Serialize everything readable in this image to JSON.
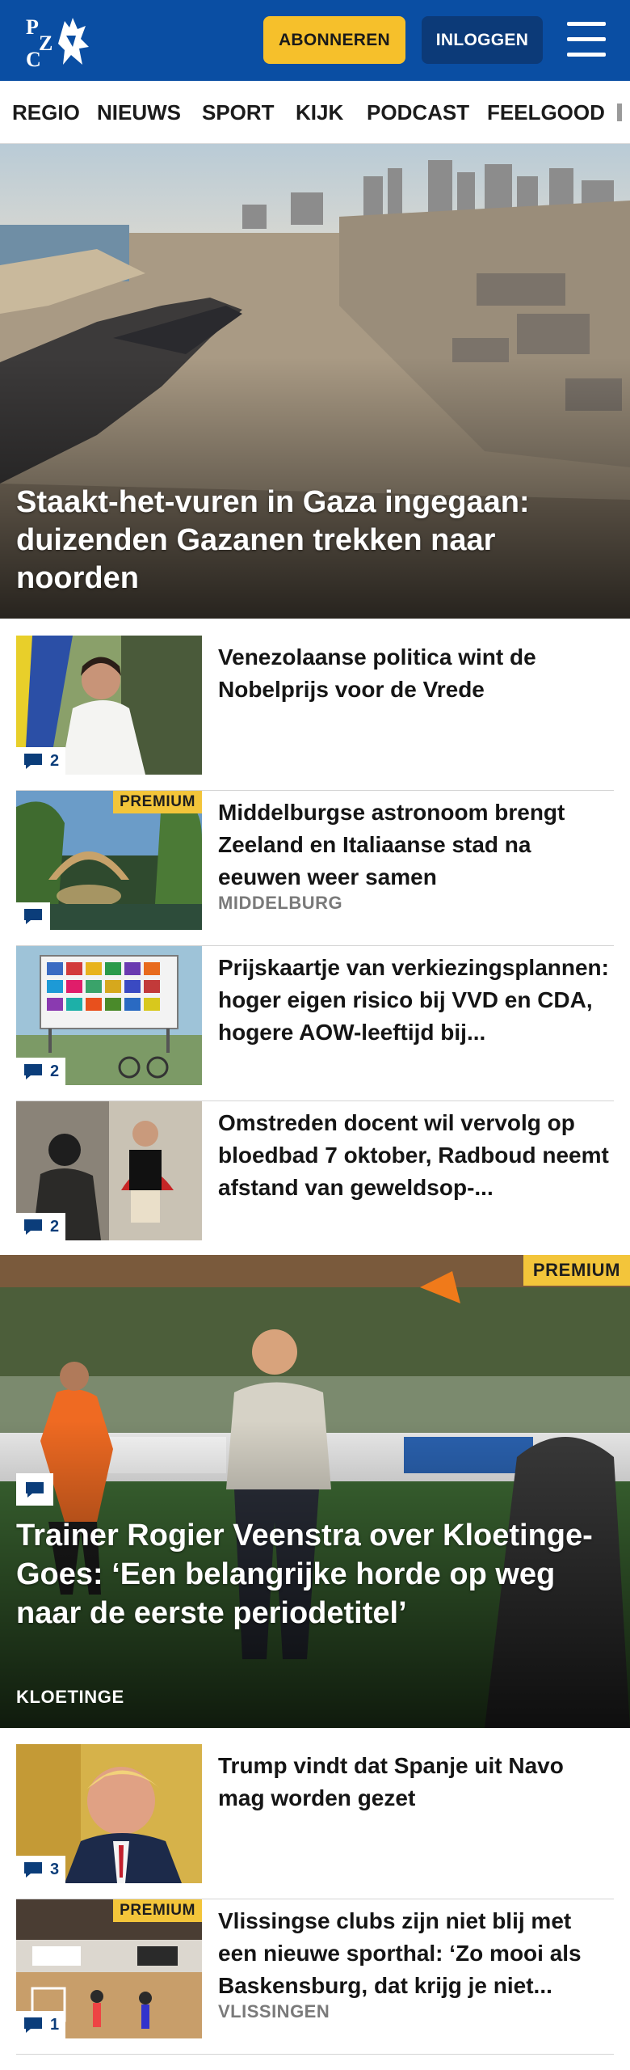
{
  "header": {
    "logo_text": "PZC",
    "subscribe_label": "ABONNEREN",
    "login_label": "INLOGGEN",
    "brand_color": "#0a4ea3",
    "accent_color": "#f6c02b"
  },
  "nav": {
    "items": [
      {
        "label": "REGIO"
      },
      {
        "label": "NIEUWS"
      },
      {
        "label": "SPORT"
      },
      {
        "label": "KIJK"
      },
      {
        "label": "PODCAST"
      },
      {
        "label": "FEELGOOD"
      }
    ]
  },
  "hero": {
    "title": "Staakt-het-vuren in Gaza ingegaan: duizenden Gazanen trekken naar noorden"
  },
  "articles": [
    {
      "title": "Venezolaanse politica wint de Nobelprijs voor de Vrede",
      "comments": "2",
      "premium": "",
      "label": ""
    },
    {
      "title": "Middelburgse astronoom brengt Zeeland en Italiaanse stad na eeuwen weer samen",
      "comments": "",
      "premium": "PREMIUM",
      "label": "MIDDELBURG"
    },
    {
      "title": "Prijskaartje van verkiezingsplan­nen: hoger eigen risico bij VVD en CDA, hogere AOW-leeftijd bij...",
      "comments": "2",
      "premium": "",
      "label": ""
    },
    {
      "title": "Omstreden docent wil vervolg op bloedbad 7 oktober, Radboud neemt afstand van geweldsop-...",
      "comments": "2",
      "premium": "",
      "label": ""
    }
  ],
  "feature": {
    "premium": "PREMIUM",
    "title": "Trainer Rogier Veenstra over Kloetinge-Goes: ‘Een belangrijke horde op weg naar de eerste periodeti­tel’",
    "label": "KLOETINGE"
  },
  "articles2": [
    {
      "title": "Trump vindt dat Spanje uit Navo mag worden gezet",
      "comments": "3",
      "premium": "",
      "label": ""
    },
    {
      "title": "Vlissingse clubs zijn niet blij met een nieuwe sporthal: ‘Zo mooi als Baskensburg, dat krijg je niet...",
      "comments": "1",
      "premium": "PREMIUM",
      "label": "VLISSINGEN"
    }
  ]
}
